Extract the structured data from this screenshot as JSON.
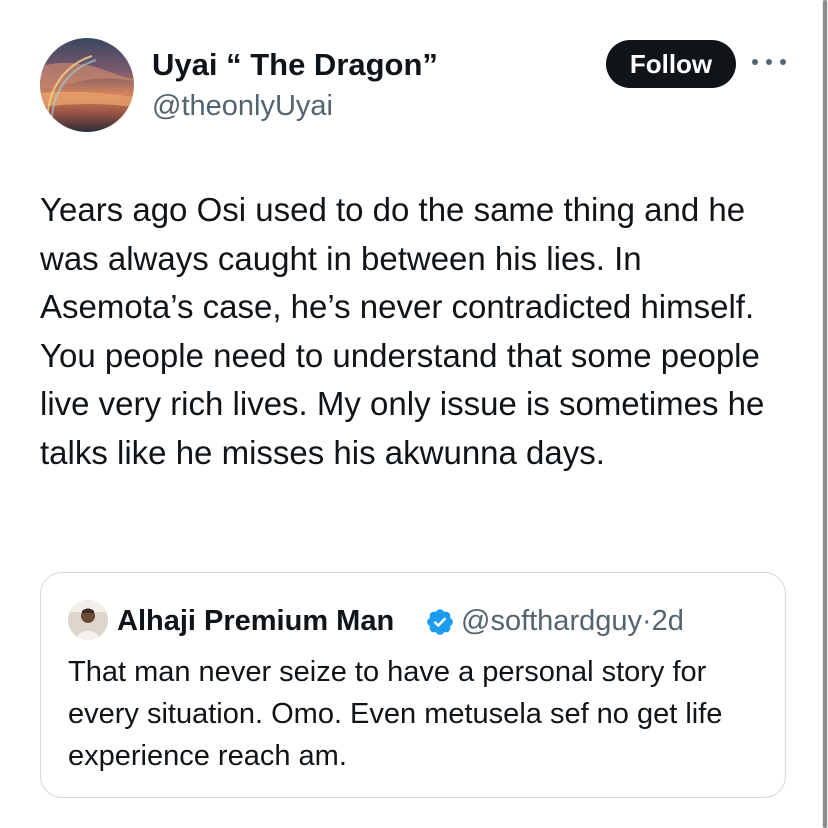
{
  "author": {
    "display_name": "Uyai “ The Dragon”",
    "handle": "@theonlyUyai",
    "avatar_icon": "sunset-sky-avatar"
  },
  "follow_button": {
    "label": "Follow",
    "color": "#0f1419",
    "text_color": "#ffffff"
  },
  "more_menu": {
    "icon": "more-horizontal-icon"
  },
  "tweet": {
    "text": "Years ago Osi used to do the same thing and he was always caught in between his lies. In Asemota’s case, he’s never contradicted himself. You people need to understand that some people live very rich lives. My only issue is sometimes he talks like he misses his akwunna days."
  },
  "quoted_tweet": {
    "display_name": "Alhaji Premium Man",
    "verified": true,
    "verified_color": "#1d9bf0",
    "handle": "@softhardguy",
    "separator": "·",
    "time": "2d",
    "avatar_icon": "person-avatar",
    "text": "That man never seize to have a personal story for every situation. Omo. Even metusela sef no get life experience reach am."
  },
  "colors": {
    "text_primary": "#0f1419",
    "text_secondary": "#536471",
    "border": "#cfd9de",
    "background": "#ffffff"
  }
}
